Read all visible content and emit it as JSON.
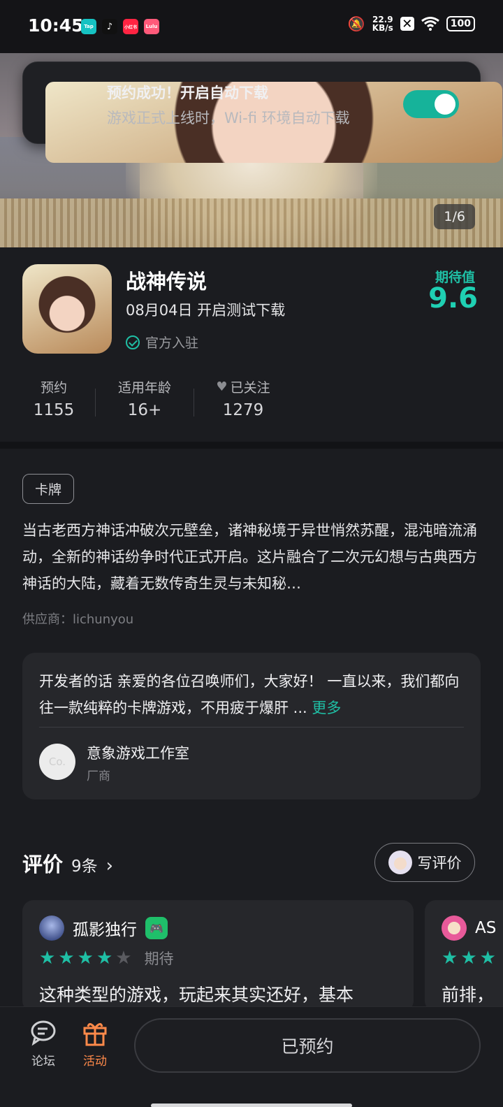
{
  "status_bar": {
    "time": "10:45",
    "apps": [
      {
        "label": "Tap",
        "color": "#16c2c2"
      },
      {
        "label": "♪",
        "color": "#111111"
      },
      {
        "label": "小红书",
        "color": "#ff2442"
      },
      {
        "label": "Lulu",
        "color": "#ff5a7a"
      }
    ],
    "net_speed_value": "22.9",
    "net_speed_unit": "KB/s",
    "battery": "100"
  },
  "banner": {
    "counter": "1/6"
  },
  "notification": {
    "title": "预约成功！开启自动下载",
    "subtitle": "游戏正式上线时，Wi-fi 环境自动下载",
    "toggle_on": true
  },
  "game": {
    "title": "战神传说",
    "release": "08月04日 开启测试下载",
    "official": "官方入驻",
    "expect_label": "期待值",
    "expect_value": "9.6",
    "stats": [
      {
        "label": "预约",
        "value": "1155"
      },
      {
        "label": "适用年龄",
        "value": "16+"
      },
      {
        "label": "已关注",
        "value": "1279"
      }
    ]
  },
  "details": {
    "tag": "卡牌",
    "description": "当古老西方神话冲破次元壁垒，诸神秘境于异世悄然苏醒，混沌暗流涌动，全新的神话纷争时代正式开启。这片融合了二次元幻想与古典西方神话的大陆，藏着无数传奇生灵与未知秘…",
    "supplier": "供应商：lichunyou"
  },
  "developer": {
    "text": "开发者的话  亲爱的各位召唤师们，大家好！ 一直以来，我们都向往一款纯粹的卡牌游戏，不用疲于爆肝 ...",
    "more": "更多",
    "avatar_text": "Co.",
    "name": "意象游戏工作室",
    "role": "厂商"
  },
  "reviews": {
    "title": "评价",
    "count": "9条",
    "write_label": "写评价",
    "items": [
      {
        "user": "孤影独行",
        "rating": 4,
        "tag": "期待",
        "text": "这种类型的游戏，玩起来其实还好，基本"
      },
      {
        "user": "AS",
        "rating": 3,
        "tag": "",
        "text": "前排，"
      }
    ]
  },
  "bottom_bar": {
    "forum_label": "论坛",
    "activity_label": "活动",
    "reserve_label": "已预约"
  },
  "colors": {
    "accent": "#1fbfa5",
    "activity": "#ff8a4a",
    "background": "#1b1c20"
  }
}
